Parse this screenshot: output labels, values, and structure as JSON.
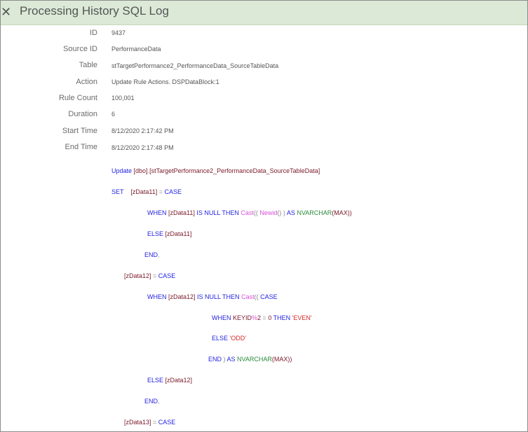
{
  "dialog": {
    "title": "Processing History SQL Log",
    "close_glyph": "✕"
  },
  "fields": [
    {
      "label": "ID",
      "value": "9437"
    },
    {
      "label": "Source ID",
      "value": "PerformanceData"
    },
    {
      "label": "Table",
      "value": "stTargetPerformance2_PerformanceData_SourceTableData"
    },
    {
      "label": "Action",
      "value": "Update Rule Actions.  DSPDataBlock:1"
    },
    {
      "label": "Rule Count",
      "value": "100,001"
    },
    {
      "label": "Duration",
      "value": "6"
    },
    {
      "label": "Start Time",
      "value": "8/12/2020 2:17:42 PM"
    },
    {
      "label": "End Time",
      "value": "8/12/2020 2:17:48 PM"
    }
  ],
  "sql": {
    "colors": {
      "keyword": "#1f1fe0",
      "identifier": "#7a1a2a",
      "function": "#d94fd9",
      "type": "#2a8a3a",
      "string": "#d62a2a",
      "operator": "#888888"
    },
    "lines": [
      [
        {
          "t": "Update",
          "c": "kw"
        },
        {
          "t": " [dbo]",
          "c": "ident"
        },
        {
          "t": ".",
          "c": "op"
        },
        {
          "t": "[stTargetPerformance2_PerformanceData_SourceTableData]",
          "c": "ident"
        }
      ],
      [
        {
          "t": "SET",
          "c": "kw"
        },
        {
          "t": "    [zData11]",
          "c": "ident"
        },
        {
          "t": " = ",
          "c": "op"
        },
        {
          "t": "CASE",
          "c": "kw"
        }
      ],
      [
        {
          "t": "WHEN",
          "c": "kw"
        },
        {
          "t": " [zData11] ",
          "c": "ident"
        },
        {
          "t": "IS NULL THEN",
          "c": "kw"
        },
        {
          "t": " Cast",
          "c": "fn"
        },
        {
          "t": "(( ",
          "c": "op"
        },
        {
          "t": "Newid",
          "c": "fn"
        },
        {
          "t": "() ) ",
          "c": "op"
        },
        {
          "t": "AS",
          "c": "kw"
        },
        {
          "t": " NVARCHAR",
          "c": "ty"
        },
        {
          "t": "(MAX))",
          "c": "ident"
        }
      ],
      [
        {
          "t": "ELSE",
          "c": "kw"
        },
        {
          "t": " [zData11]",
          "c": "ident"
        }
      ],
      [
        {
          "t": "END",
          "c": "kw"
        },
        {
          "t": ",",
          "c": "op"
        }
      ],
      [
        {
          "t": "[zData12]",
          "c": "ident"
        },
        {
          "t": " = ",
          "c": "op"
        },
        {
          "t": "CASE",
          "c": "kw"
        }
      ],
      [
        {
          "t": "WHEN",
          "c": "kw"
        },
        {
          "t": " [zData12] ",
          "c": "ident"
        },
        {
          "t": "IS NULL THEN",
          "c": "kw"
        },
        {
          "t": " Cast",
          "c": "fn"
        },
        {
          "t": "(( ",
          "c": "op"
        },
        {
          "t": "CASE",
          "c": "kw"
        }
      ],
      [
        {
          "t": "WHEN",
          "c": "kw"
        },
        {
          "t": " KEYID",
          "c": "ident"
        },
        {
          "t": "%",
          "c": "fn"
        },
        {
          "t": "2 ",
          "c": "ident"
        },
        {
          "t": "=",
          "c": "op"
        },
        {
          "t": " 0 ",
          "c": "ident"
        },
        {
          "t": "THEN",
          "c": "kw"
        },
        {
          "t": " 'EVEN'",
          "c": "str"
        }
      ],
      [
        {
          "t": "ELSE",
          "c": "kw"
        },
        {
          "t": " 'ODD'",
          "c": "str"
        }
      ],
      [
        {
          "t": "END",
          "c": "kw"
        },
        {
          "t": " ) ",
          "c": "op"
        },
        {
          "t": "AS",
          "c": "kw"
        },
        {
          "t": " NVARCHAR",
          "c": "ty"
        },
        {
          "t": "(MAX))",
          "c": "ident"
        }
      ],
      [
        {
          "t": "ELSE",
          "c": "kw"
        },
        {
          "t": " [zData12]",
          "c": "ident"
        }
      ],
      [
        {
          "t": "END",
          "c": "kw"
        },
        {
          "t": ",",
          "c": "op"
        }
      ],
      [
        {
          "t": "[zData13]",
          "c": "ident"
        },
        {
          "t": " = ",
          "c": "op"
        },
        {
          "t": "CASE",
          "c": "kw"
        }
      ]
    ]
  }
}
